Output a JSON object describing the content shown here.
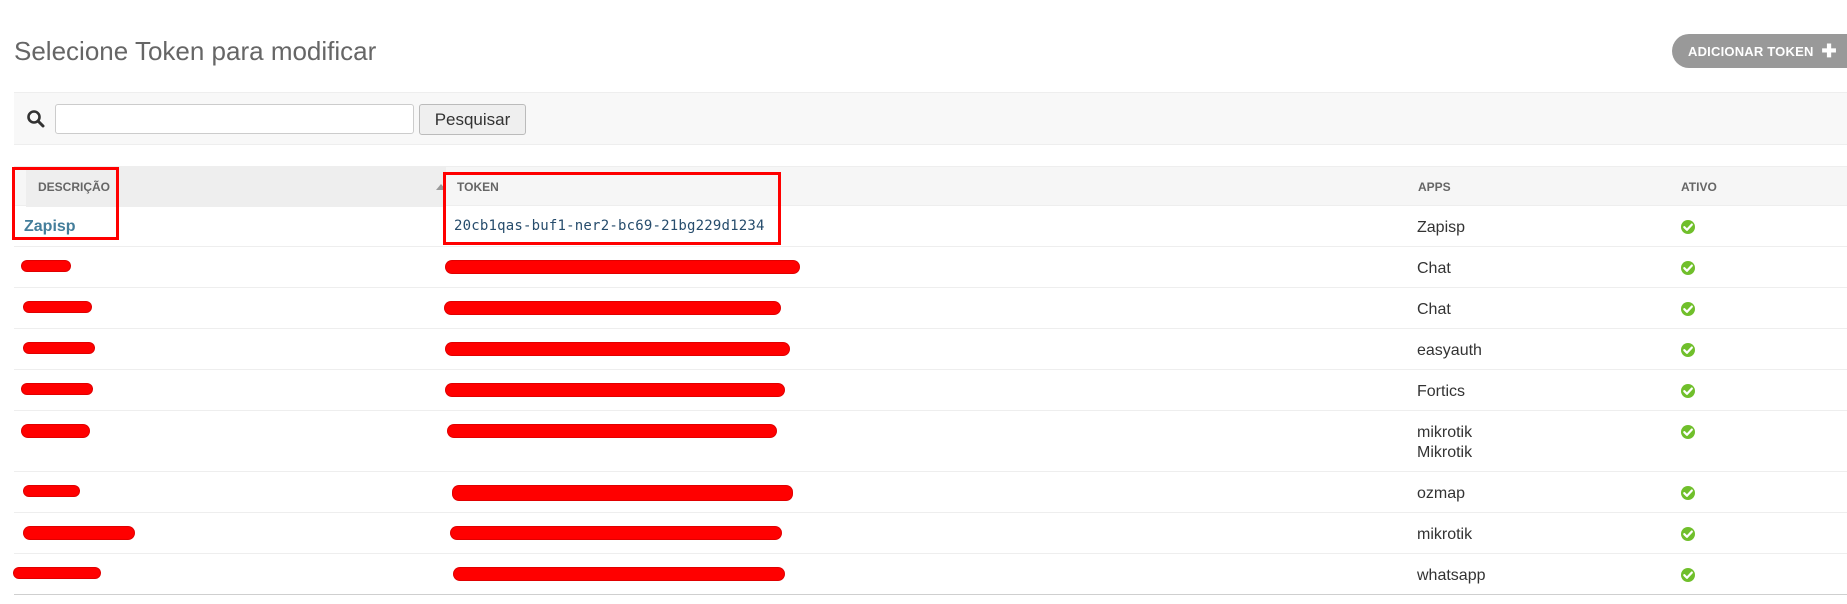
{
  "page": {
    "title": "Selecione Token para modificar",
    "add_button_label": "ADICIONAR TOKEN",
    "add_icon": "plus-icon"
  },
  "search": {
    "value": "",
    "placeholder": "",
    "button_label": "Pesquisar",
    "icon": "search-icon"
  },
  "table": {
    "headers": {
      "descricao": "DESCRIÇÃO",
      "token": "TOKEN",
      "apps": "APPS",
      "ativo": "ATIVO"
    },
    "rows": [
      {
        "descricao": "Zapisp",
        "token": "20cb1qas-buf1-ner2-bc69-21bg229d1234",
        "apps": [
          "Zapisp"
        ],
        "ativo": true
      },
      {
        "descricao": "",
        "token": "",
        "apps": [
          "Chat"
        ],
        "ativo": true
      },
      {
        "descricao": "",
        "token": "",
        "apps": [
          "Chat"
        ],
        "ativo": true
      },
      {
        "descricao": "",
        "token": "",
        "apps": [
          "easyauth"
        ],
        "ativo": true
      },
      {
        "descricao": "",
        "token": "",
        "apps": [
          "Fortics"
        ],
        "ativo": true
      },
      {
        "descricao": "",
        "token": "",
        "apps": [
          "mikrotik",
          "Mikrotik"
        ],
        "ativo": true
      },
      {
        "descricao": "",
        "token": "",
        "apps": [
          "ozmap"
        ],
        "ativo": true
      },
      {
        "descricao": "",
        "token": "",
        "apps": [
          "mikrotik"
        ],
        "ativo": true
      },
      {
        "descricao": "",
        "token": "",
        "apps": [
          "whatsapp"
        ],
        "ativo": true
      }
    ]
  },
  "colors": {
    "link": "#447e9b",
    "active_icon": "#70bf2b",
    "redaction": "#ff0000",
    "button_gray": "#999999"
  }
}
